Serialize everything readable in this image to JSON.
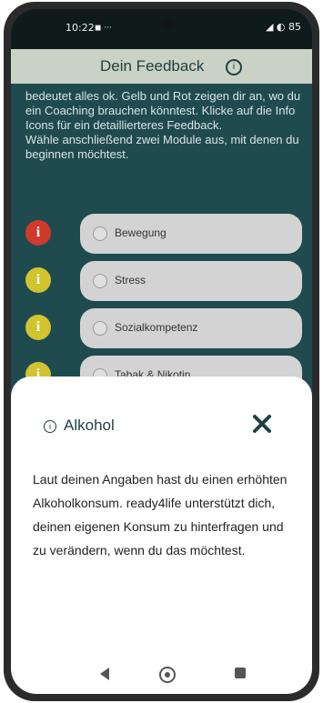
{
  "status": {
    "time": "10:22",
    "time_icons": "◼ ···",
    "right": "◢ ◐ 85"
  },
  "header": {
    "title": "Dein Feedback",
    "info_icon": "info-icon"
  },
  "intro": {
    "text": "bedeutet alles ok. Gelb und Rot zeigen dir an, wo du ein Coaching brauchen könntest. Klicke auf die Info Icons für ein detaillierteres Feedback.\nWähle anschließend zwei Module aus, mit denen du beginnen möchtest."
  },
  "modules": [
    {
      "label": "Bewegung",
      "color": "#cf3b2a"
    },
    {
      "label": "Stress",
      "color": "#d2c330"
    },
    {
      "label": "Sozialkompetenz",
      "color": "#d2c330"
    },
    {
      "label": "Tabak & Nikotin",
      "color": "#d2c330"
    }
  ],
  "sheet": {
    "title": "Alkohol",
    "body": "Laut deinen Angaben hast du einen erhöhten Alkoholkonsum. ready4life unterstützt dich, deinen eigenen Konsum zu hinterfragen und zu verändern, wenn du das möchtest."
  },
  "nav": {
    "back_icon": "back-icon",
    "home_icon": "home-icon",
    "recent_icon": "recent-apps-icon"
  },
  "colors": {
    "background": "#1f4b4f",
    "header": "#c9d2c4",
    "accent_dark": "#1e4145",
    "pill": "#d3d3d3"
  }
}
